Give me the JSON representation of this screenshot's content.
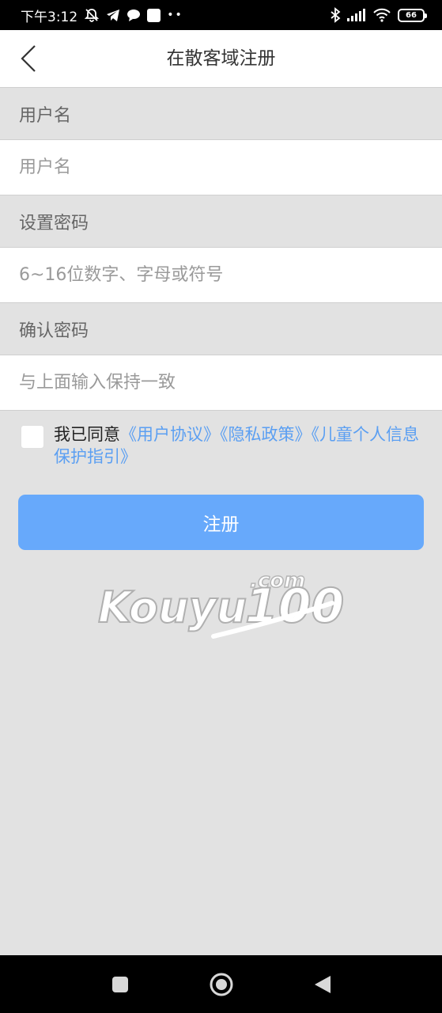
{
  "status_bar": {
    "time": "下午3:12",
    "battery": "66",
    "icons": [
      "mute-bell-icon",
      "telegram-icon",
      "chat-bubble-icon",
      "app-square-icon",
      "more-dots-icon",
      "bluetooth-icon",
      "signal-icon",
      "wifi-icon",
      "battery-icon"
    ]
  },
  "nav": {
    "title": "在散客域注册",
    "back_icon": "chevron-left-icon"
  },
  "form": {
    "username": {
      "label": "用户名",
      "placeholder": "用户名",
      "value": ""
    },
    "password": {
      "label": "设置密码",
      "placeholder": "6~16位数字、字母或符号",
      "value": ""
    },
    "confirm": {
      "label": "确认密码",
      "placeholder": "与上面输入保持一致",
      "value": ""
    }
  },
  "agreement": {
    "prefix": "我已同意",
    "links": [
      "《用户协议》",
      "《隐私政策》",
      "《儿童个人信息保护指引》"
    ],
    "checked": false
  },
  "register_label": "注册",
  "logo": {
    "com": ".com",
    "brand": "Kouyu",
    "number": "100"
  },
  "colors": {
    "accent": "#67a9fb",
    "link": "#5b9ff2",
    "background": "#e2e2e2"
  }
}
